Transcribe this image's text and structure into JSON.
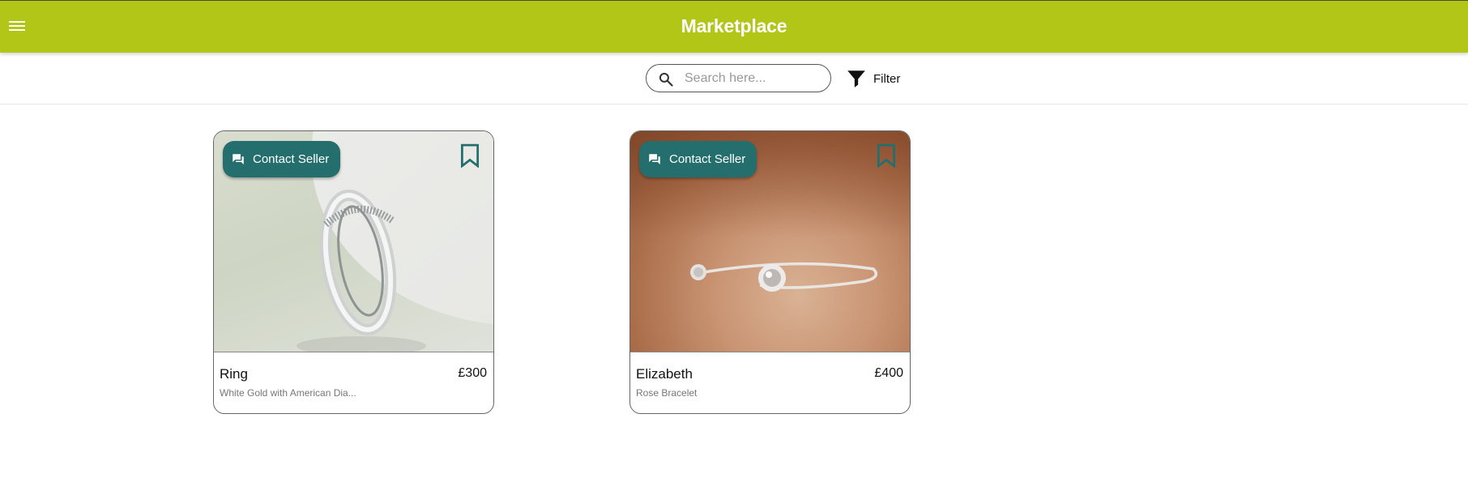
{
  "app": {
    "title": "Marketplace",
    "accent": "#b2c618",
    "button_color": "#256e6e"
  },
  "toolbar": {
    "search_placeholder": "Search here...",
    "filter_label": "Filter"
  },
  "products": [
    {
      "title": "Ring",
      "price": "£300",
      "description": "White Gold with American Dia...",
      "contact_label": "Contact Seller"
    },
    {
      "title": "Elizabeth",
      "price": "£400",
      "description": "Rose Bracelet",
      "contact_label": "Contact Seller"
    }
  ]
}
